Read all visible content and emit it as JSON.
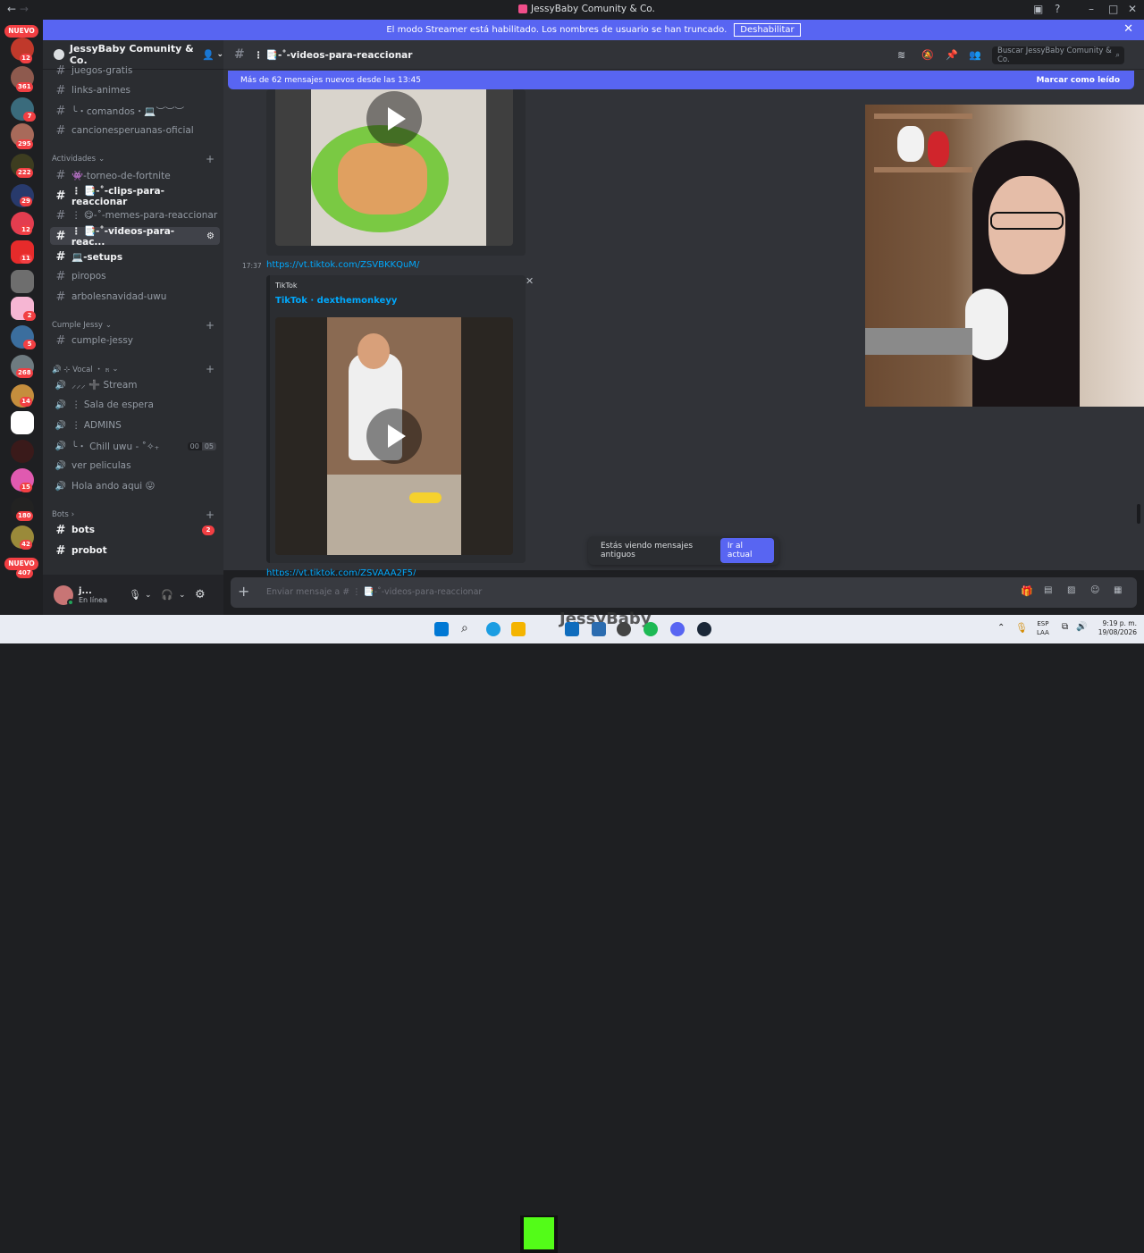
{
  "window": {
    "title": "JessyBaby Comunity & Co."
  },
  "banner": {
    "text": "El modo Streamer está habilitado. Los nombres de usuario se han truncado.",
    "button": "Deshabilitar"
  },
  "rail": {
    "nuevo_top": "NUEVO",
    "nuevo_bottom": "NUEVO",
    "badges": [
      "12",
      "361",
      "7",
      "295",
      "222",
      "29",
      "12",
      "11",
      "2",
      "5",
      "268",
      "14",
      "15",
      "180",
      "42",
      "407"
    ]
  },
  "sidebar": {
    "server_name": "JessyBaby Comunity & Co.",
    "channels": [
      {
        "name": "juegos-gratis"
      },
      {
        "name": "links-animes"
      },
      {
        "name": "╰・comandos・💻︶︶︶"
      },
      {
        "name": "cancionesperuanas-oficial"
      }
    ],
    "cat_actividades": "Actividades",
    "actividades": [
      {
        "name": "👾-torneo-de-fortnite"
      },
      {
        "name": "⋮ 📑-˚-clips-para-reaccionar"
      },
      {
        "name": "⋮ 😋-˚-memes-para-reaccionar"
      },
      {
        "name": "⋮ 📑-˚-videos-para-reac..."
      },
      {
        "name": "💻-setups"
      },
      {
        "name": "piropos"
      },
      {
        "name": "arbolesnavidad-uwu"
      }
    ],
    "cat_cumple": "Cumple Jessy",
    "cumple": [
      {
        "name": "cumple-jessy"
      }
    ],
    "cat_vocal": "🔊 ⊹ Vocal ・ ೫",
    "vocal": [
      {
        "name": "⸝⸝⸝ ➕ Stream"
      },
      {
        "name": "⋮ Sala de espera"
      },
      {
        "name": "⋮ ADMINS"
      },
      {
        "name": "╰・ Chill uwu - ˚✧₊"
      },
      {
        "name": "ver peliculas"
      },
      {
        "name": "Hola ando aqui 😛"
      }
    ],
    "chill_counts": [
      "00",
      "05"
    ],
    "cat_bots": "Bots",
    "bots": [
      {
        "name": "bots",
        "badge": "2"
      },
      {
        "name": "probot"
      }
    ],
    "user": {
      "name": "j...",
      "status": "En línea"
    }
  },
  "header": {
    "channel": "⋮ 📑-˚-videos-para-reaccionar",
    "search_placeholder": "Buscar JessyBaby Comunity & Co."
  },
  "newbar": {
    "text": "Más de 62 mensajes nuevos desde las 13:45",
    "action": "Marcar como leído"
  },
  "messages": {
    "time": "17:37",
    "link": "https://vt.tiktok.com/ZSVBKKQuM/",
    "embed_provider": "TikTok",
    "embed_title": "TikTok · dexthemonkeyy",
    "next_link": "https://vt.tiktok.com/ZSVAAA2F5/"
  },
  "old_msgs": {
    "text": "Estás viendo mensajes antiguos",
    "button": "Ir al actual"
  },
  "composer": {
    "placeholder": "Enviar mensaje a # ⋮ 📑-˚-videos-para-reaccionar"
  },
  "taskbar": {
    "lang_top": "ESP",
    "lang_bottom": "LAA",
    "time": "9:19 p. m.",
    "date": "19/08/2026",
    "overlay_text": "JessyBaby"
  },
  "colors": {
    "accent": "#5865f2",
    "badge": "#f23f43",
    "link": "#00a8fc"
  }
}
